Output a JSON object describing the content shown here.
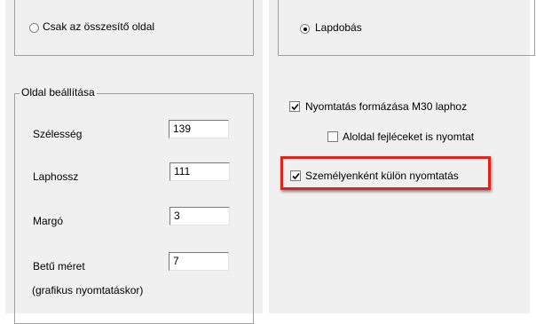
{
  "print_mode": {
    "summary_page_only_label": "Csak az összesítő oldal",
    "summary_page_only_selected": false,
    "page_break_label": "Lapdobás",
    "page_break_selected": true
  },
  "page_settings": {
    "legend": "Oldal beállítása",
    "width_label": "Szélesség",
    "width_value": "139",
    "page_length_label": "Laphossz",
    "page_length_value": "111",
    "margin_label": "Margó",
    "margin_value": "3",
    "font_size_label": "Betű méret",
    "font_size_value": "7",
    "graphics_note": "(grafikus nyomtatáskor)"
  },
  "options": {
    "m30_format_label": "Nyomtatás formázása M30 laphoz",
    "m30_format_checked": true,
    "subpage_headers_label": "Aloldal fejléceket is nyomtat",
    "subpage_headers_checked": false,
    "per_person_label": "Személyenként külön nyomtatás",
    "per_person_checked": true
  },
  "colors": {
    "highlight": "#e2231a",
    "panel_bg": "#f0f0f0"
  }
}
